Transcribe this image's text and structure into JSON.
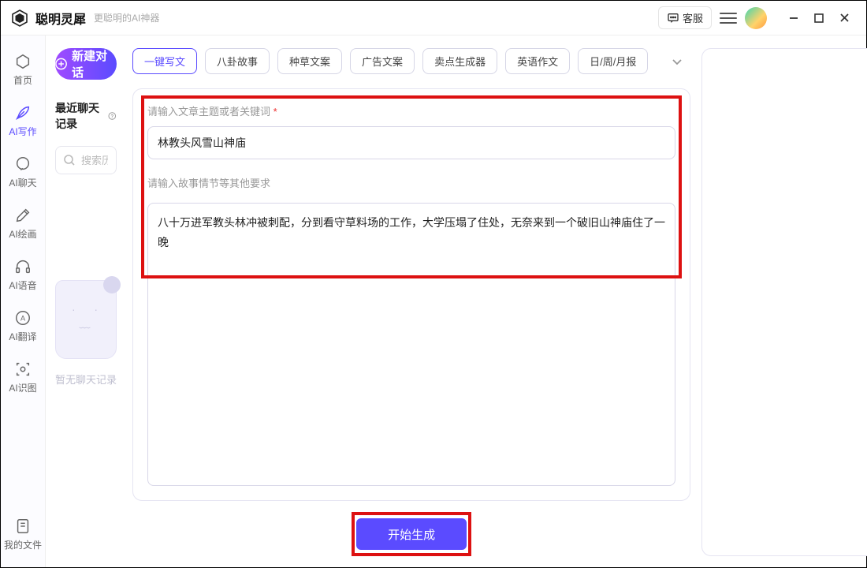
{
  "header": {
    "app_title": "聪明灵犀",
    "tagline": "更聪明的AI神器",
    "support_label": "客服"
  },
  "sidebar": {
    "items": [
      {
        "id": "home",
        "label": "首页"
      },
      {
        "id": "write",
        "label": "AI写作"
      },
      {
        "id": "chat",
        "label": "AI聊天"
      },
      {
        "id": "paint",
        "label": "AI绘画"
      },
      {
        "id": "voice",
        "label": "AI语音"
      },
      {
        "id": "translate",
        "label": "AI翻译"
      },
      {
        "id": "vision",
        "label": "AI识图"
      }
    ],
    "files_label": "我的文件"
  },
  "history": {
    "new_chat_label": "新建对话",
    "recent_title": "最近聊天记录",
    "search_placeholder": "搜索历史记录",
    "empty_label": "暂无聊天记录"
  },
  "tabs": {
    "items": [
      {
        "id": "one_key",
        "label": "一键写文",
        "active": true
      },
      {
        "id": "gossip",
        "label": "八卦故事"
      },
      {
        "id": "seed",
        "label": "种草文案"
      },
      {
        "id": "ad",
        "label": "广告文案"
      },
      {
        "id": "sell",
        "label": "卖点生成器"
      },
      {
        "id": "eng",
        "label": "英语作文"
      },
      {
        "id": "report",
        "label": "日/周/月报"
      }
    ]
  },
  "form": {
    "topic_label": "请输入文章主题或者关键词",
    "topic_value": "林教头风雪山神庙",
    "detail_label": "请输入故事情节等其他要求",
    "detail_value": "八十万进军教头林冲被刺配，分到看守草料场的工作，大学压塌了住处，无奈来到一个破旧山神庙住了一晚",
    "generate_label": "开始生成"
  }
}
